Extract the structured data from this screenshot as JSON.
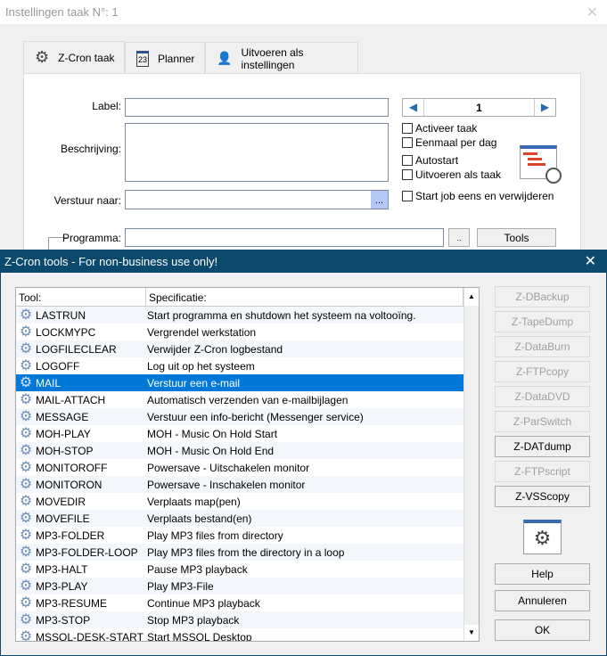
{
  "window": {
    "title": "Instellingen taak N°: 1",
    "close": "✕"
  },
  "tabs": [
    {
      "label": "Z-Cron taak",
      "icon": "gear-icon"
    },
    {
      "label": "Planner",
      "icon": "calendar-icon"
    },
    {
      "label": "Uitvoeren als instellingen",
      "icon": "user-icon"
    }
  ],
  "form": {
    "label_label": "Label:",
    "label_value": "",
    "description_label": "Beschrijving:",
    "send_to_label": "Verstuur naar:",
    "browse": "...",
    "program_label": "Programma:",
    "program_browse": "..",
    "tools": "Tools",
    "counter": "1"
  },
  "checkboxes": [
    "Activeer taak",
    "Eenmaal per dag",
    "Autostart",
    "Uitvoeren als taak",
    "Start job eens en verwijderen"
  ],
  "dialog": {
    "title": "Z-Cron tools - For non-business use only!",
    "close": "✕",
    "columns": [
      "Tool:",
      "Specificatie:"
    ],
    "rows": [
      [
        "LASTRUN",
        "Start programma en shutdown het systeem na voltooïng."
      ],
      [
        "LOCKMYPC",
        "Vergrendel werkstation"
      ],
      [
        "LOGFILECLEAR",
        "Verwijder Z-Cron logbestand"
      ],
      [
        "LOGOFF",
        "Log uit op het systeem"
      ],
      [
        "MAIL",
        "Verstuur een e-mail"
      ],
      [
        "MAIL-ATTACH",
        "Automatisch verzenden van e-mailbijlagen"
      ],
      [
        "MESSAGE",
        "Verstuur een info-bericht (Messenger service)"
      ],
      [
        "MOH-PLAY",
        "MOH - Music On Hold Start"
      ],
      [
        "MOH-STOP",
        "MOH - Music On Hold End"
      ],
      [
        "MONITOROFF",
        "Powersave - Uitschakelen monitor"
      ],
      [
        "MONITORON",
        "Powersave - Inschakelen monitor"
      ],
      [
        "MOVEDIR",
        "Verplaats map(pen)"
      ],
      [
        "MOVEFILE",
        "Verplaats bestand(en)"
      ],
      [
        "MP3-FOLDER",
        "Play MP3 files from directory"
      ],
      [
        "MP3-FOLDER-LOOP",
        "Play MP3 files from the directory in a loop"
      ],
      [
        "MP3-HALT",
        "Pause MP3 playback"
      ],
      [
        "MP3-PLAY",
        "Play MP3-File"
      ],
      [
        "MP3-RESUME",
        "Continue MP3 playback"
      ],
      [
        "MP3-STOP",
        "Stop MP3 playback"
      ],
      [
        "MSSQL-DESK-START",
        "Start MSSQL Desktop"
      ]
    ],
    "selected_index": 4,
    "tool_buttons": [
      {
        "label": "Z-DBackup",
        "enabled": false
      },
      {
        "label": "Z-TapeDump",
        "enabled": false
      },
      {
        "label": "Z-DataBurn",
        "enabled": false
      },
      {
        "label": "Z-FTPcopy",
        "enabled": false
      },
      {
        "label": "Z-DataDVD",
        "enabled": false
      },
      {
        "label": "Z-ParSwitch",
        "enabled": false
      },
      {
        "label": "Z-DATdump",
        "enabled": true
      },
      {
        "label": "Z-FTPscript",
        "enabled": false
      },
      {
        "label": "Z-VSScopy",
        "enabled": true
      }
    ],
    "help": "Help",
    "cancel": "Annuleren",
    "ok": "OK"
  },
  "colors": {
    "accent": "#0078d7",
    "dialog_title": "#0c4a6d"
  }
}
